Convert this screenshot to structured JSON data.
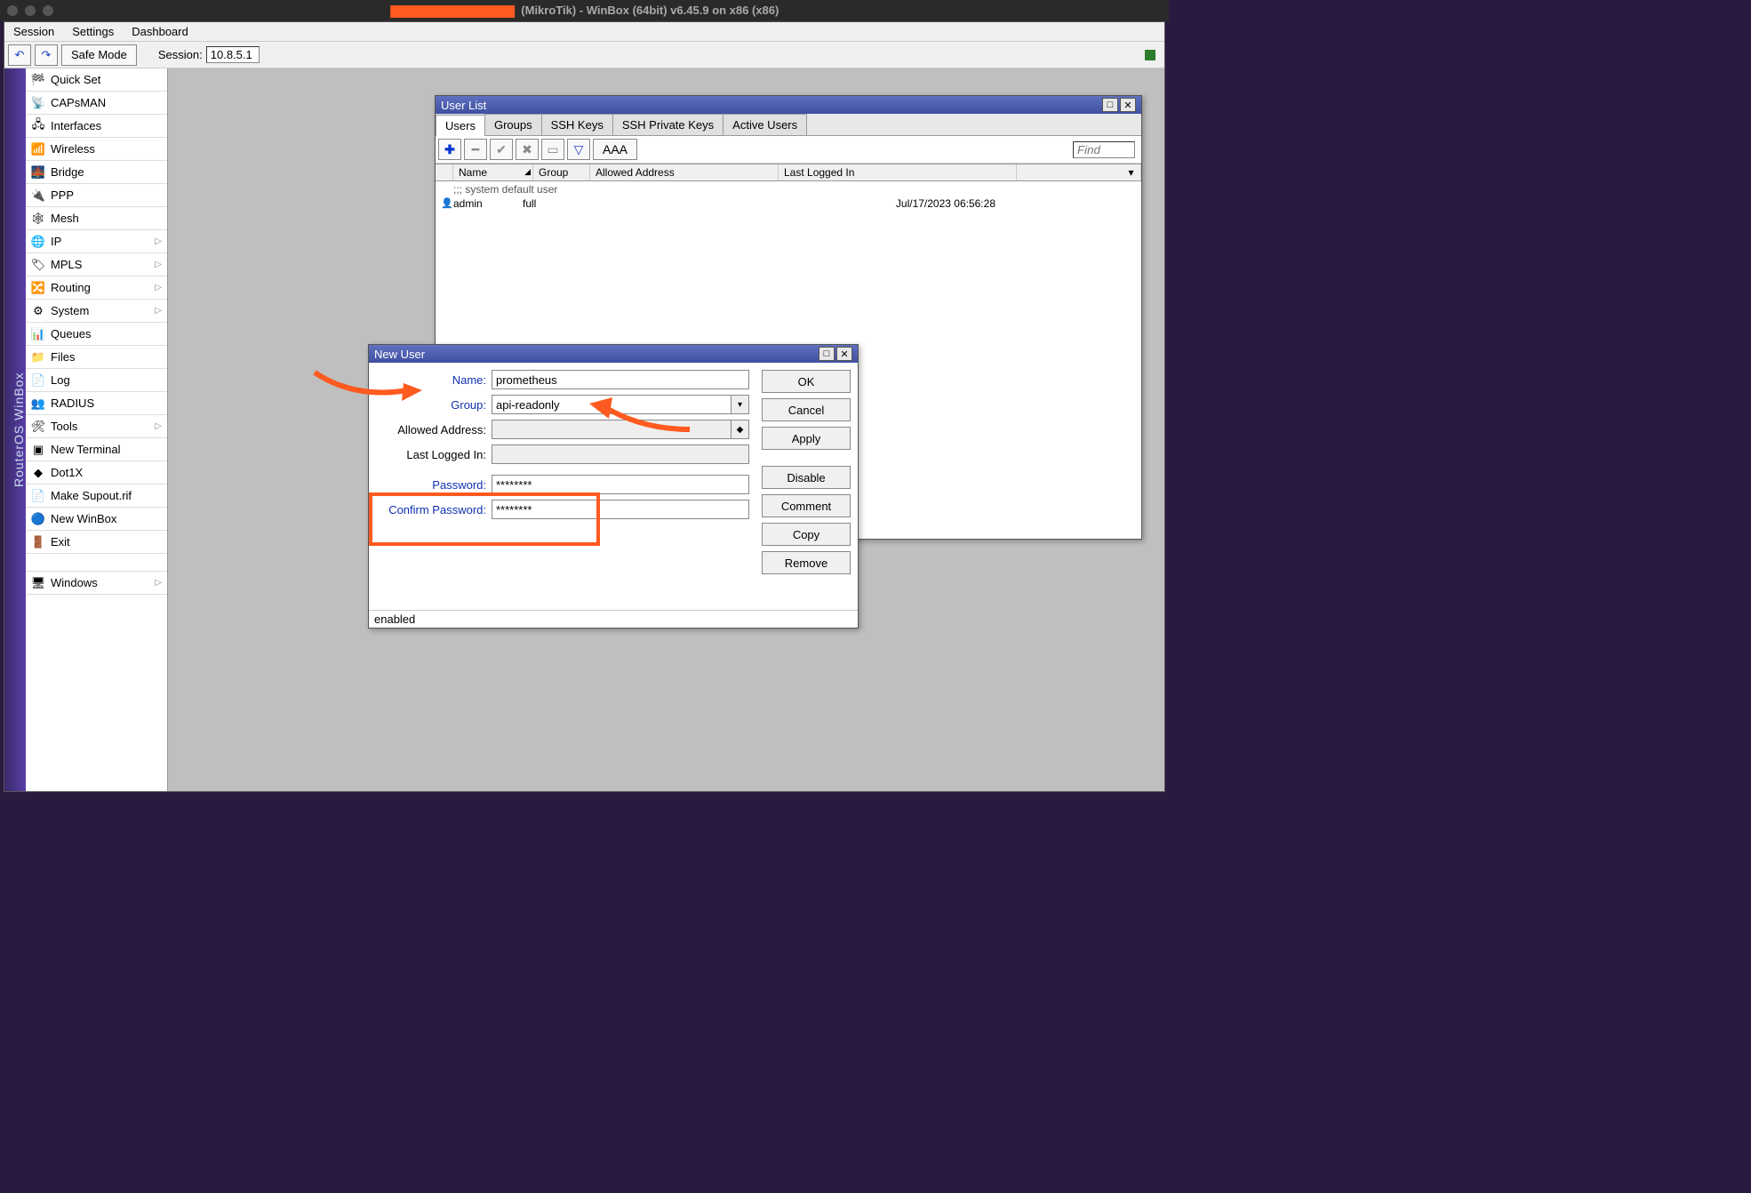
{
  "title_bar": {
    "app_title": "(MikroTik) - WinBox (64bit) v6.45.9 on x86 (x86)"
  },
  "menubar": {
    "items": [
      "Session",
      "Settings",
      "Dashboard"
    ]
  },
  "toolbar": {
    "undo": "↶",
    "redo": "↷",
    "safe_mode": "Safe Mode",
    "session_label": "Session:",
    "session_value": "10.8.5.1"
  },
  "vertical_label": "RouterOS WinBox",
  "sidebar": {
    "items": [
      {
        "label": "Quick Set",
        "icon": "🏁",
        "arrow": false
      },
      {
        "label": "CAPsMAN",
        "icon": "📡",
        "arrow": false
      },
      {
        "label": "Interfaces",
        "icon": "🖧",
        "arrow": false
      },
      {
        "label": "Wireless",
        "icon": "📶",
        "arrow": false
      },
      {
        "label": "Bridge",
        "icon": "🌉",
        "arrow": false
      },
      {
        "label": "PPP",
        "icon": "🔌",
        "arrow": false
      },
      {
        "label": "Mesh",
        "icon": "🕸",
        "arrow": false
      },
      {
        "label": "IP",
        "icon": "🌐",
        "arrow": true
      },
      {
        "label": "MPLS",
        "icon": "🏷",
        "arrow": true
      },
      {
        "label": "Routing",
        "icon": "🔀",
        "arrow": true
      },
      {
        "label": "System",
        "icon": "⚙",
        "arrow": true
      },
      {
        "label": "Queues",
        "icon": "📊",
        "arrow": false
      },
      {
        "label": "Files",
        "icon": "📁",
        "arrow": false
      },
      {
        "label": "Log",
        "icon": "📄",
        "arrow": false
      },
      {
        "label": "RADIUS",
        "icon": "👥",
        "arrow": false
      },
      {
        "label": "Tools",
        "icon": "🛠",
        "arrow": true
      },
      {
        "label": "New Terminal",
        "icon": "▣",
        "arrow": false
      },
      {
        "label": "Dot1X",
        "icon": "◆",
        "arrow": false
      },
      {
        "label": "Make Supout.rif",
        "icon": "📄",
        "arrow": false
      },
      {
        "label": "New WinBox",
        "icon": "🔵",
        "arrow": false
      },
      {
        "label": "Exit",
        "icon": "🚪",
        "arrow": false
      }
    ],
    "windows_item": {
      "label": "Windows",
      "icon": "🖥",
      "arrow": true
    }
  },
  "userlist_window": {
    "title": "User List",
    "tabs": [
      "Users",
      "Groups",
      "SSH Keys",
      "SSH Private Keys",
      "Active Users"
    ],
    "active_tab": 0,
    "toolbar": {
      "aaa": "AAA",
      "find_placeholder": "Find"
    },
    "columns": [
      "Name",
      "Group",
      "Allowed Address",
      "Last Logged In"
    ],
    "comment_row": ";;; system default user",
    "rows": [
      {
        "name": "admin",
        "group": "full",
        "addr": "",
        "log": "Jul/17/2023 06:56:28"
      }
    ]
  },
  "newuser_window": {
    "title": "New User",
    "labels": {
      "name": "Name:",
      "group": "Group:",
      "allowed": "Allowed Address:",
      "lastlog": "Last Logged In:",
      "password": "Password:",
      "confirm": "Confirm Password:"
    },
    "values": {
      "name": "prometheus",
      "group": "api-readonly",
      "allowed": "",
      "lastlog": "",
      "password": "********",
      "confirm": "********"
    },
    "buttons": [
      "OK",
      "Cancel",
      "Apply",
      "Disable",
      "Comment",
      "Copy",
      "Remove"
    ],
    "status": "enabled"
  }
}
